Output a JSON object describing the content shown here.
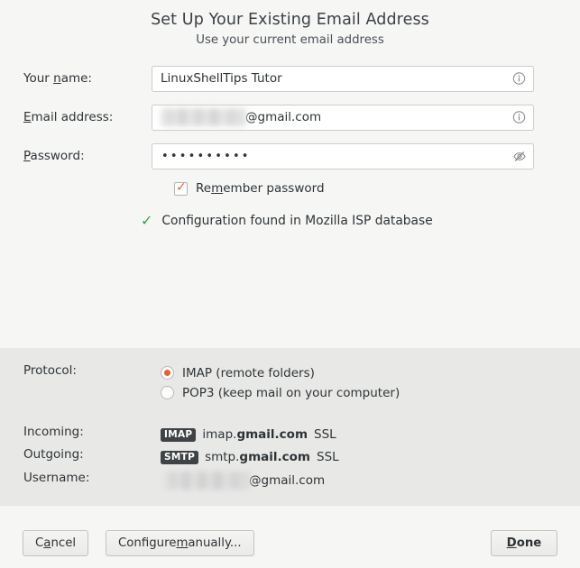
{
  "header": {
    "title": "Set Up Your Existing Email Address",
    "subtitle": "Use your current email address"
  },
  "form": {
    "name": {
      "label_pre": "Your ",
      "label_accel": "n",
      "label_post": "ame:",
      "value": "LinuxShellTips Tutor",
      "info_icon": "info-circle-icon"
    },
    "email": {
      "label_pre": "",
      "label_accel": "E",
      "label_post": "mail address:",
      "value_redacted": true,
      "value_suffix": "@gmail.com",
      "info_icon": "info-circle-icon"
    },
    "password": {
      "label_pre": "",
      "label_accel": "P",
      "label_post": "assword:",
      "value": "••••••••••",
      "reveal_icon": "eye-slash-icon"
    },
    "remember": {
      "label_pre": "Re",
      "label_accel": "m",
      "label_post": "ember password",
      "checked": true,
      "check_color": "#e8622c"
    },
    "status": {
      "icon": "green-check-icon",
      "color": "#2eaa3e",
      "text": "Configuration found in Mozilla ISP database"
    }
  },
  "details": {
    "protocol": {
      "label": "Protocol:",
      "selected": "IMAP",
      "accent": "#e8622c",
      "options": [
        {
          "value": "IMAP",
          "label": "IMAP (remote folders)",
          "selected": true
        },
        {
          "value": "POP3",
          "label": "POP3 (keep mail on your computer)",
          "selected": false
        }
      ]
    },
    "incoming": {
      "label": "Incoming:",
      "badge": "IMAP",
      "host_plain": "imap.",
      "host_bold": "gmail.com",
      "security": "SSL"
    },
    "outgoing": {
      "label": "Outgoing:",
      "badge": "SMTP",
      "host_plain": "smtp.",
      "host_bold": "gmail.com",
      "security": "SSL"
    },
    "username": {
      "label": "Username:",
      "value_redacted": true,
      "value_suffix": "@gmail.com"
    },
    "badge_color": "#3f4346"
  },
  "footer": {
    "cancel": {
      "pre": "C",
      "accel": "a",
      "post": "ncel"
    },
    "configure": {
      "pre": "Configure ",
      "accel": "m",
      "post": "anually..."
    },
    "done": {
      "pre": "",
      "accel": "D",
      "post": "one"
    }
  }
}
